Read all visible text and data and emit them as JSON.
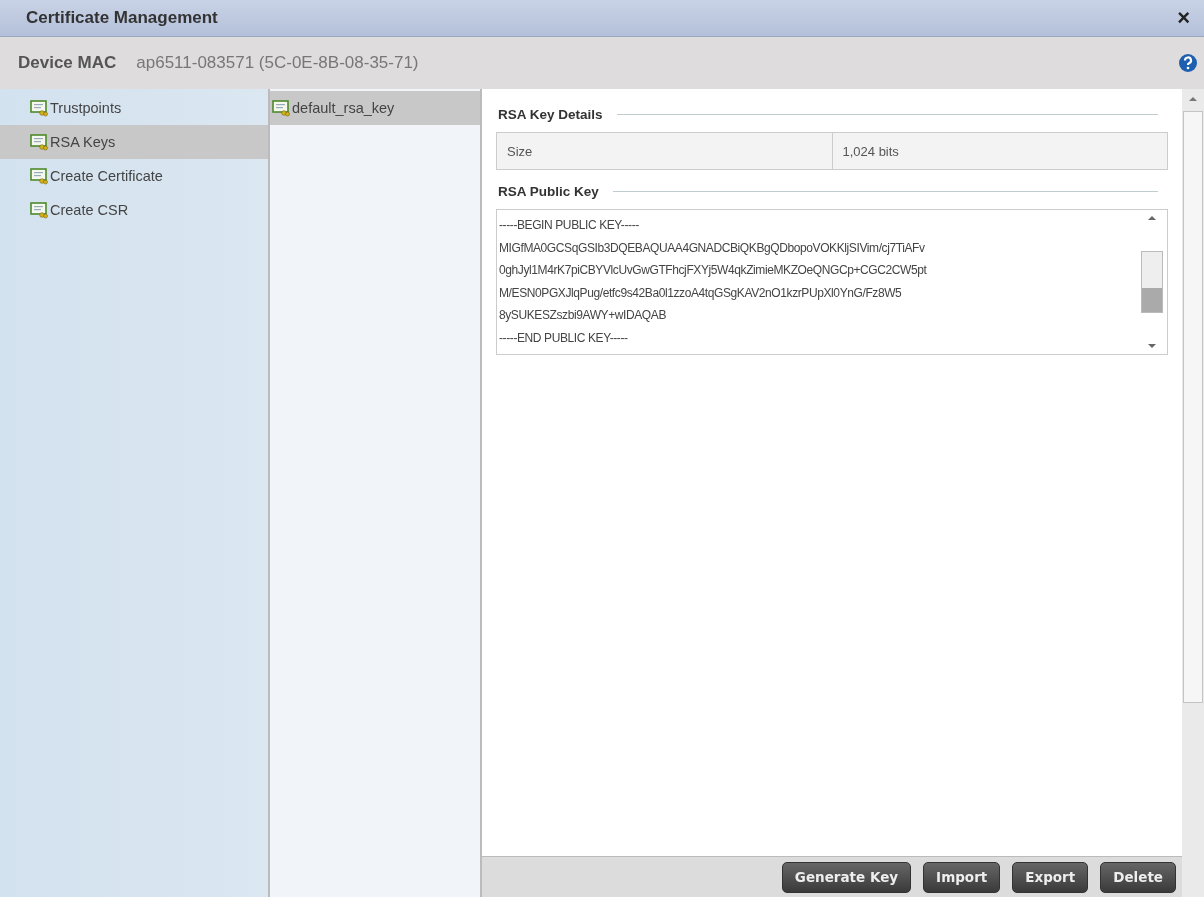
{
  "window": {
    "title": "Certificate Management",
    "close": "×"
  },
  "device": {
    "label": "Device MAC",
    "value": "ap6511-083571 (5C-0E-8B-08-35-71)"
  },
  "nav": [
    {
      "label": "Trustpoints",
      "selected": false
    },
    {
      "label": "RSA Keys",
      "selected": true
    },
    {
      "label": "Create Certificate",
      "selected": false
    },
    {
      "label": "Create CSR",
      "selected": false
    }
  ],
  "keys": [
    {
      "label": "default_rsa_key",
      "selected": true
    }
  ],
  "details": {
    "title": "RSA Key Details",
    "rows": [
      {
        "name": "Size",
        "value": "1,024 bits"
      }
    ]
  },
  "public_key": {
    "title": "RSA Public Key",
    "lines": [
      "-----BEGIN PUBLIC KEY-----",
      "MIGfMA0GCSqGSIb3DQEBAQUAA4GNADCBiQKBgQDbopoVOKKljSIVim/cj7TiAFv",
      "0ghJyl1M4rK7piCBYVlcUvGwGTFhcjFXYj5W4qkZimieMKZOeQNGCp+CGC2CW5pt",
      "M/ESN0PGXJlqPug/etfc9s42Ba0l1zzoA4tqGSgKAV2nO1kzrPUpXl0YnG/Fz8W5",
      "8ySUKESZszbi9AWY+wIDAQAB",
      "-----END PUBLIC KEY-----"
    ]
  },
  "buttons": [
    "Generate Key",
    "Import",
    "Export",
    "Delete"
  ]
}
